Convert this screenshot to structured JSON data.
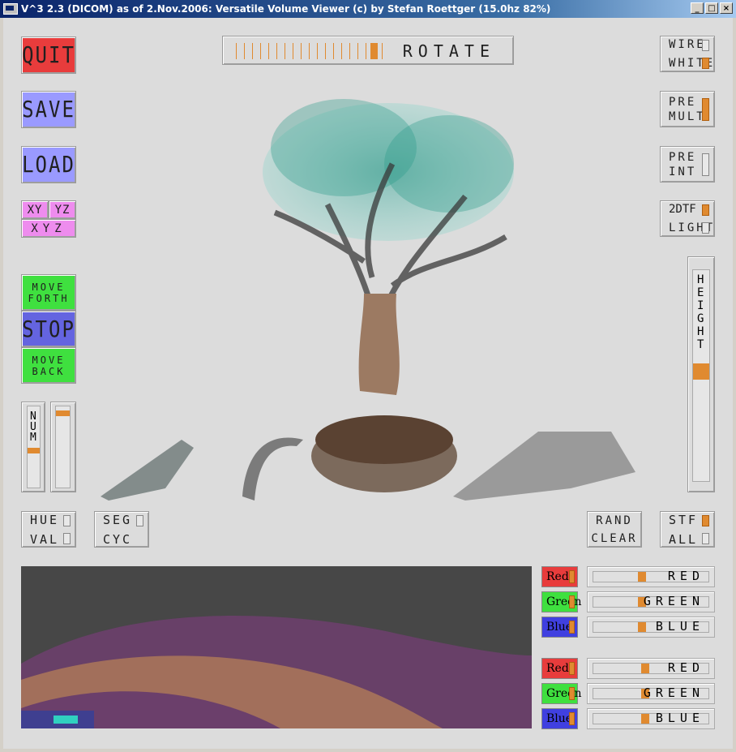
{
  "window": {
    "title": "V^3 2.3 (DICOM) as of 2.Nov.2006: Versatile Volume Viewer (c) by Stefan Roettger (15.0hz 82%)",
    "minimize": "_",
    "maximize": "□",
    "close": "×"
  },
  "left": {
    "quit": "QUIT",
    "save": "SAVE",
    "load": "LOAD",
    "xy": "XY",
    "yz": "YZ",
    "xyz": "XYZ",
    "move_forth_1": "MOVE",
    "move_forth_2": "FORTH",
    "stop": "STOP",
    "move_back_1": "MOVE",
    "move_back_2": "BACK",
    "num": "NUM",
    "num_value": 0.45,
    "second_value": 0.95,
    "hue": "HUE",
    "val": "VAL",
    "seg": "SEG",
    "cyc": "CYC"
  },
  "top": {
    "rotate": "ROTATE",
    "rotate_value": 0.52
  },
  "right": {
    "wire": "WIRE",
    "white": "WHITE",
    "pre_mult_1": "PRE",
    "pre_mult_2": "MULT",
    "pre_int_1": "PRE",
    "pre_int_2": "INT",
    "dtf": "2DTF",
    "light": "LIGHT",
    "height": "HEIGHT",
    "height_value": 0.52,
    "rand": "RAND",
    "clear": "CLEAR",
    "stf": "STF",
    "all": "ALL"
  },
  "color_sliders": {
    "group1": [
      {
        "btn": "Red",
        "label": "RED",
        "value": 0.42,
        "color": "#e83c3c"
      },
      {
        "btn": "Green",
        "label": "GREEN",
        "value": 0.42,
        "color": "#3fe03f"
      },
      {
        "btn": "Blue",
        "label": "BLUE",
        "value": 0.42,
        "color": "#4040e0"
      }
    ],
    "group2": [
      {
        "btn": "Red",
        "label": "RED",
        "value": 0.45,
        "color": "#e83c3c"
      },
      {
        "btn": "Green",
        "label": "GREEN",
        "value": 0.45,
        "color": "#3fe03f"
      },
      {
        "btn": "Blue",
        "label": "BLUE",
        "value": 0.45,
        "color": "#4040e0"
      }
    ]
  },
  "colors": {
    "accent": "#e08a30",
    "quit": "#e83c3c",
    "save_load": "#9a9aff",
    "views": "#ee8cee",
    "move": "#3fe03f",
    "stop": "#6464e0"
  }
}
